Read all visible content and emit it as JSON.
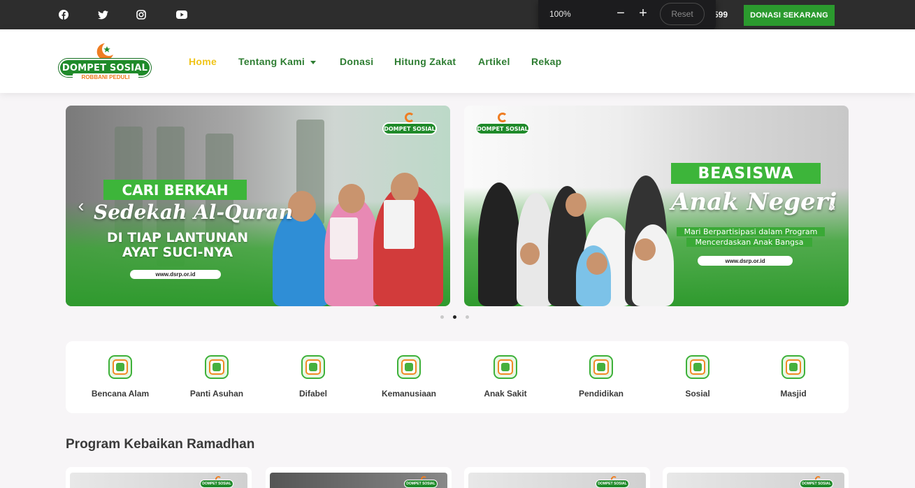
{
  "topbar": {
    "social": [
      {
        "name": "facebook-icon"
      },
      {
        "name": "twitter-icon"
      },
      {
        "name": "instagram-icon"
      },
      {
        "name": "youtube-icon"
      }
    ],
    "phone_fragment": "599",
    "donate_label": "DONASI SEKARANG"
  },
  "zoom": {
    "level": "100%",
    "minus": "−",
    "plus": "+",
    "reset": "Reset"
  },
  "logo": {
    "title": "DOMPET SOSIAL",
    "subtitle": "ROBBANI PEDULI"
  },
  "nav": {
    "items": [
      {
        "label": "Home",
        "active": true
      },
      {
        "label": "Tentang Kami",
        "dropdown": true
      },
      {
        "label": "Donasi"
      },
      {
        "label": "Hitung Zakat"
      },
      {
        "label": "Artikel"
      },
      {
        "label": "Rekap"
      }
    ]
  },
  "slider": {
    "slides": [
      {
        "logo": "DOMPET SOSIAL",
        "tag": "CARI BERKAH",
        "script": "Sedekah Al-Quran",
        "line1": "DI TIAP LANTUNAN",
        "line2": "AYAT SUCI-NYA",
        "url": "www.dsrp.or.id"
      },
      {
        "logo": "DOMPET SOSIAL",
        "tag": "BEASISWA",
        "script": "Anak Negeri",
        "sub1": "Mari Berpartisipasi dalam Program",
        "sub2": "Mencerdaskan Anak Bangsa",
        "url": "www.dsrp.or.id"
      }
    ],
    "prev": "‹",
    "next": "›",
    "dots": 3,
    "active_dot": 1
  },
  "categories": [
    {
      "label": "Bencana Alam",
      "icon": "disaster-icon"
    },
    {
      "label": "Panti Asuhan",
      "icon": "orphanage-icon"
    },
    {
      "label": "Difabel",
      "icon": "wheelchair-icon"
    },
    {
      "label": "Kemanusiaan",
      "icon": "humanity-icon"
    },
    {
      "label": "Anak Sakit",
      "icon": "sick-child-icon"
    },
    {
      "label": "Pendidikan",
      "icon": "education-icon"
    },
    {
      "label": "Sosial",
      "icon": "social-icon"
    },
    {
      "label": "Masjid",
      "icon": "mosque-icon"
    }
  ],
  "section": {
    "title": "Program Kebaikan Ramadhan",
    "card_logo": "DOMPET SOSIAL"
  },
  "colors": {
    "brand_green": "#2b9a2e",
    "nav_green": "#2e7d32",
    "active_yellow": "#f0c419",
    "accent_orange": "#ef7d22",
    "topbar": "#2d2d2d"
  }
}
